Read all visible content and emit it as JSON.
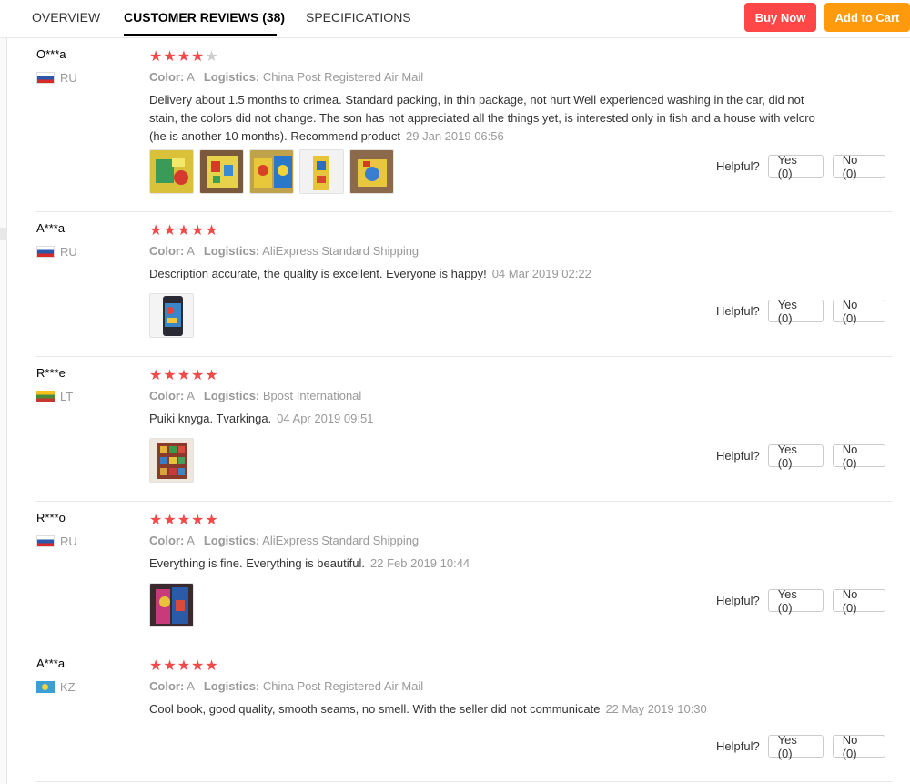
{
  "tabs": [
    {
      "label": "OVERVIEW"
    },
    {
      "label": "CUSTOMER REVIEWS (38)"
    },
    {
      "label": "SPECIFICATIONS"
    }
  ],
  "actions": {
    "buy_now": "Buy Now",
    "add_to_cart": "Add to Cart"
  },
  "colors": {
    "buy": "#ff4747",
    "cart": "#ff9a0d",
    "star": "#f24a4a"
  },
  "labels": {
    "color": "Color:",
    "logistics": "Logistics:",
    "helpful": "Helpful?"
  },
  "reviews": [
    {
      "user": "O***a",
      "country": "RU",
      "rating": 4,
      "color": "A",
      "logistics": "China Post Registered Air Mail",
      "text": "Delivery about 1.5 months to crimea. Standard packing, in thin package, not hurt Well experienced washing in the car, did not stain, the colors did not change. The son has not appreciated all the things yet, is interested only in fish and a house with velcro (he is another 10 months). Recommend product",
      "date": "29 Jan 2019 06:56",
      "photos": 5,
      "yes": "Yes (0)",
      "no": "No (0)"
    },
    {
      "user": "A***a",
      "country": "RU",
      "rating": 5,
      "color": "A",
      "logistics": "AliExpress Standard Shipping",
      "text": "Description accurate, the quality is excellent. Everyone is happy!",
      "date": "04 Mar 2019 02:22",
      "photos": 1,
      "yes": "Yes (0)",
      "no": "No (0)"
    },
    {
      "user": "R***e",
      "country": "LT",
      "rating": 5,
      "color": "A",
      "logistics": "Bpost International",
      "text": "Puiki knyga. Tvarkinga.",
      "date": "04 Apr 2019 09:51",
      "photos": 1,
      "yes": "Yes (0)",
      "no": "No (0)"
    },
    {
      "user": "R***o",
      "country": "RU",
      "rating": 5,
      "color": "A",
      "logistics": "AliExpress Standard Shipping",
      "text": "Everything is fine. Everything is beautiful.",
      "date": "22 Feb 2019 10:44",
      "photos": 1,
      "yes": "Yes (0)",
      "no": "No (0)"
    },
    {
      "user": "A***a",
      "country": "KZ",
      "rating": 5,
      "color": "A",
      "logistics": "China Post Registered Air Mail",
      "text": "Cool book, good quality, smooth seams, no smell. With the seller did not communicate",
      "date": "22 May 2019 10:30",
      "photos": 0,
      "yes": "Yes (0)",
      "no": "No (0)"
    }
  ]
}
